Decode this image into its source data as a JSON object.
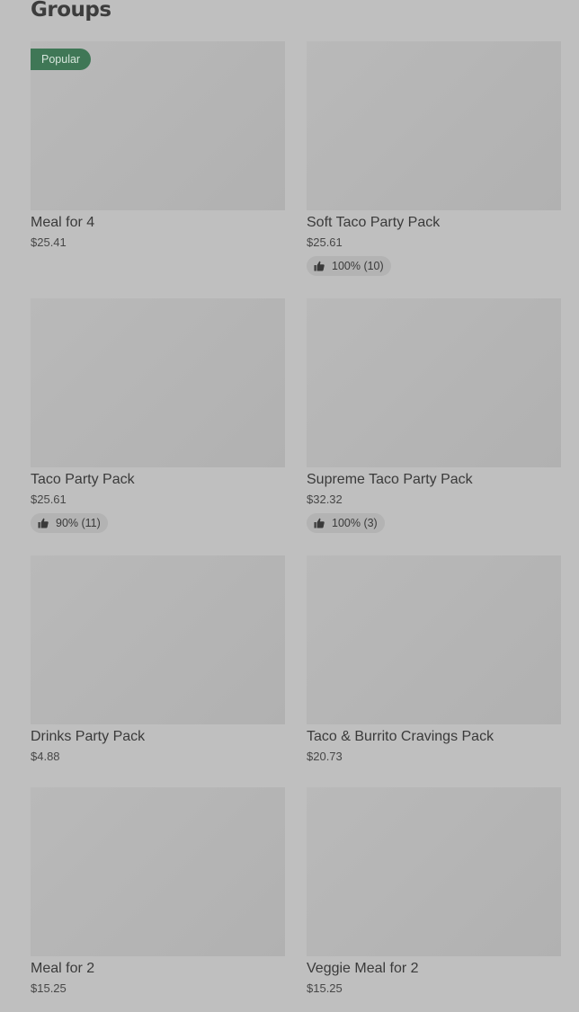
{
  "section": {
    "title": "Groups"
  },
  "items": [
    {
      "name": "Meal for 4",
      "price": "$25.41",
      "badge": "Popular"
    },
    {
      "name": "Soft Taco Party Pack",
      "price": "$25.61",
      "rating": "100% (10)"
    },
    {
      "name": "Taco Party Pack",
      "price": "$25.61",
      "rating": "90% (11)"
    },
    {
      "name": "Supreme Taco Party Pack",
      "price": "$32.32",
      "rating": "100% (3)"
    },
    {
      "name": "Drinks Party Pack",
      "price": "$4.88"
    },
    {
      "name": "Taco & Burrito Cravings Pack",
      "price": "$20.73"
    },
    {
      "name": "Meal for 2",
      "price": "$15.25"
    },
    {
      "name": "Veggie Meal for 2",
      "price": "$15.25"
    }
  ],
  "icons": {
    "rating": "thumbs-up-icon"
  },
  "colors": {
    "background": "#bfbfbf",
    "image_placeholder": "#b3b3b3",
    "popular_badge": "#3f7756"
  }
}
